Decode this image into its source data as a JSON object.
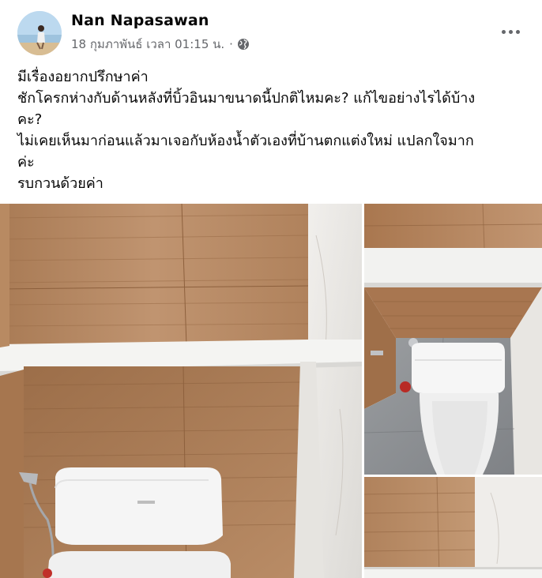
{
  "post": {
    "author": "Nan Napasawan",
    "timestamp": "18 กุมภาพันธ์ เวลา 01:15 น.",
    "separator": "·",
    "audience_icon": "globe-icon",
    "more_icon": "more-horizontal-icon",
    "text_lines": [
      "มีเรื่องอยากปรึกษาค่า",
      "ชักโครกห่างกับด้านหลังที่บิ้วอินมาขนาดนี้ปกติไหมคะ? แก้ไขอย่างไรได้บ้าง",
      "คะ?",
      "ไม่เคยเห็นมาก่อนแล้วมาเจอกับห้องน้ำตัวเองที่บ้านตกแต่งใหม่ แปลกใจมาก",
      "ค่ะ",
      "รบกวนด้วยค่า"
    ]
  },
  "colors": {
    "wood": "#b88a62",
    "wood_dark": "#a9774f",
    "shelf": "#f2f2f0",
    "tile_white": "#ecebe8",
    "floor_gray": "#8e9194",
    "toilet": "#f4f4f4"
  }
}
